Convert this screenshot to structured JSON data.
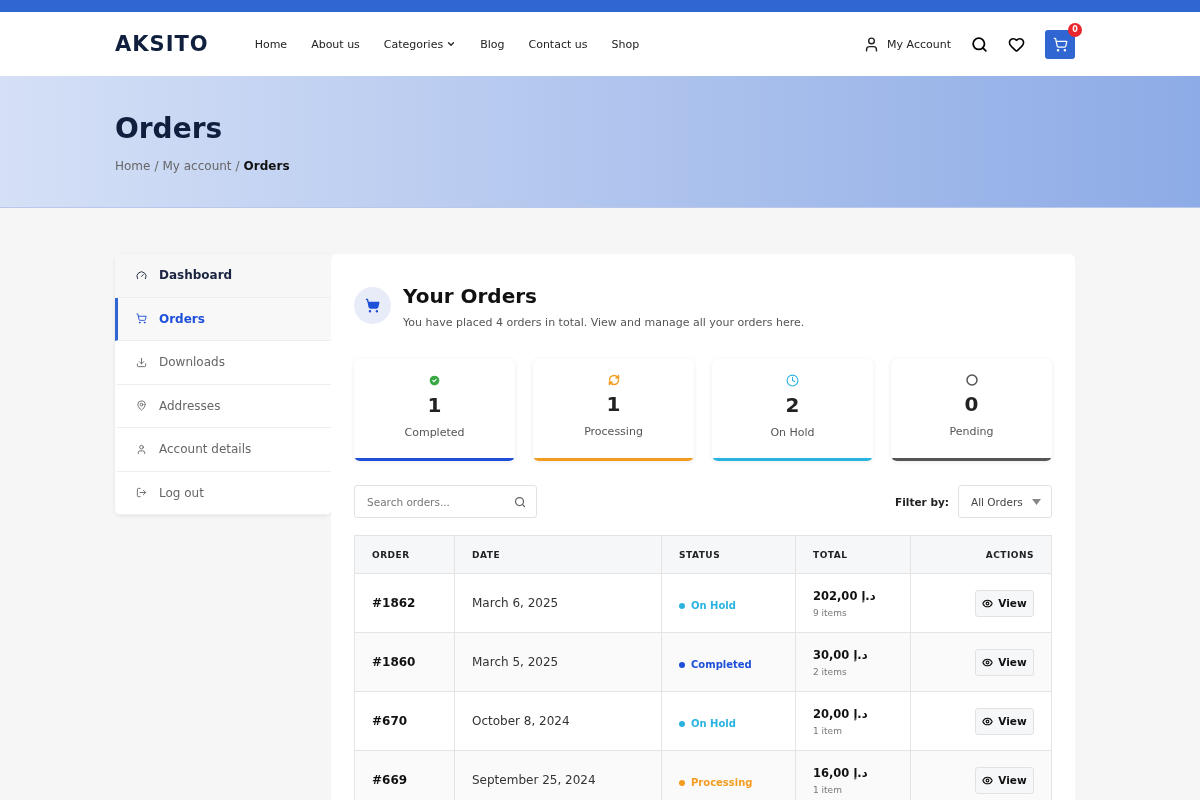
{
  "header": {
    "logo": "AKSITO",
    "nav": [
      {
        "label": "Home",
        "has_caret": false
      },
      {
        "label": "About us",
        "has_caret": false
      },
      {
        "label": "Categories",
        "has_caret": true
      },
      {
        "label": "Blog",
        "has_caret": false
      },
      {
        "label": "Contact us",
        "has_caret": false
      },
      {
        "label": "Shop",
        "has_caret": false
      }
    ],
    "account": "My Account",
    "cart_count": "0"
  },
  "hero": {
    "title": "Orders",
    "breadcrumb": [
      {
        "label": "Home",
        "current": false
      },
      {
        "sep": "/",
        "label": "My account",
        "current": false
      },
      {
        "sep": "/",
        "label": "Orders",
        "current": true
      }
    ]
  },
  "sidebar": {
    "items": [
      {
        "label": "Dashboard",
        "kind": "dashboard",
        "selected": false
      },
      {
        "label": "Orders",
        "kind": "orders",
        "selected": true
      },
      {
        "label": "Downloads",
        "kind": "downloads",
        "selected": false
      },
      {
        "label": "Addresses",
        "kind": "addresses",
        "selected": false
      },
      {
        "label": "Account details",
        "kind": "account",
        "selected": false
      },
      {
        "label": "Log out",
        "kind": "logout",
        "selected": false
      }
    ]
  },
  "orders": {
    "title": "Your Orders",
    "subtitle": "You have placed 4 orders in total. View and manage all your orders here.",
    "stats": [
      {
        "kind": "completed",
        "count": "1",
        "label": "Completed",
        "color": "#1e4fd8"
      },
      {
        "kind": "processing",
        "count": "1",
        "label": "Processing",
        "color": "#f39c1f"
      },
      {
        "kind": "on_hold",
        "count": "2",
        "label": "On Hold",
        "color": "#2bb3e0"
      },
      {
        "kind": "pending",
        "count": "0",
        "label": "Pending",
        "color": "#555555"
      }
    ],
    "search": {
      "placeholder": "Search orders..."
    },
    "filter": {
      "label": "Filter by:",
      "value": "All Orders"
    },
    "table": {
      "columns": [
        "ORDER",
        "DATE",
        "STATUS",
        "TOTAL",
        "ACTIONS"
      ],
      "rows": [
        {
          "order": "#1862",
          "date": "March 6, 2025",
          "status": "On Hold",
          "color": "#2bb3e0",
          "total": "202,00 د.إ",
          "items": "9 items",
          "action": "View"
        },
        {
          "order": "#1860",
          "date": "March 5, 2025",
          "status": "Completed",
          "color": "#1e4fd8",
          "total": "30,00 د.إ",
          "items": "2 items",
          "action": "View"
        },
        {
          "order": "#670",
          "date": "October 8, 2024",
          "status": "On Hold",
          "color": "#2bb3e0",
          "total": "20,00 د.إ",
          "items": "1 item",
          "action": "View"
        },
        {
          "order": "#669",
          "date": "September 25, 2024",
          "status": "Processing",
          "color": "#f39c1f",
          "total": "16,00 د.إ",
          "items": "1 item",
          "action": "View"
        }
      ]
    }
  }
}
